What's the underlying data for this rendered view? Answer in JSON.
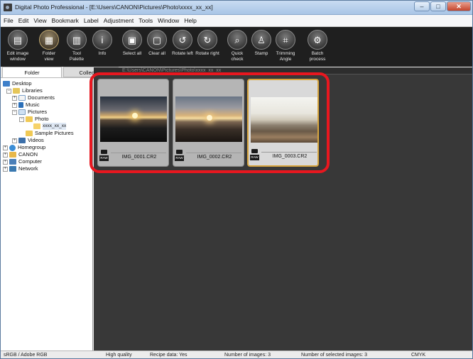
{
  "window": {
    "title": "Digital Photo Professional - [E:\\Users\\CANON\\Pictures\\Photo\\xxxx_xx_xx]",
    "buttons": {
      "minimize": "–",
      "maximize": "□",
      "close": "✕"
    }
  },
  "menu": [
    "File",
    "Edit",
    "View",
    "Bookmark",
    "Label",
    "Adjustment",
    "Tools",
    "Window",
    "Help"
  ],
  "toolbar": {
    "tools": [
      {
        "id": "edit-image-window",
        "label": "Edit image\nwindow",
        "icon": "edit-image-icon",
        "glyph": "▤",
        "active": false
      },
      {
        "id": "folder-view",
        "label": "Folder\nview",
        "icon": "folder-view-icon",
        "glyph": "▦",
        "active": true
      },
      {
        "id": "tool-palette",
        "label": "Tool\nPalette",
        "icon": "tool-palette-icon",
        "glyph": "▥",
        "active": false
      },
      {
        "id": "info",
        "label": "Info",
        "icon": "info-icon",
        "glyph": "i",
        "active": false
      },
      {
        "id": "select-all",
        "label": "Select all",
        "icon": "select-all-icon",
        "glyph": "▣",
        "active": false
      },
      {
        "id": "clear-all",
        "label": "Clear all",
        "icon": "clear-all-icon",
        "glyph": "▢",
        "active": false
      },
      {
        "id": "rotate-left",
        "label": "Rotate left",
        "icon": "rotate-left-icon",
        "glyph": "↺",
        "active": false
      },
      {
        "id": "rotate-right",
        "label": "Rotate right",
        "icon": "rotate-right-icon",
        "glyph": "↻",
        "active": false
      },
      {
        "id": "quick-check",
        "label": "Quick\ncheck",
        "icon": "quick-check-icon",
        "glyph": "⌕",
        "active": false
      },
      {
        "id": "stamp",
        "label": "Stamp",
        "icon": "stamp-icon",
        "glyph": "♙",
        "active": false
      },
      {
        "id": "trimming-angle",
        "label": "Trimming\nAngle",
        "icon": "trimming-angle-icon",
        "glyph": "⌗",
        "active": false
      },
      {
        "id": "batch-process",
        "label": "Batch\nprocess",
        "icon": "batch-process-icon",
        "glyph": "⚙",
        "active": false
      }
    ]
  },
  "tabs": {
    "folder": "Folder",
    "collection": "Collection"
  },
  "tree": {
    "desktop": "Desktop",
    "libraries": "Libraries",
    "documents": "Documents",
    "music": "Music",
    "pictures": "Pictures",
    "photo": "Photo",
    "date_folder": "xxxx_xx_xx",
    "sample_pictures": "Sample Pictures",
    "videos": "Videos",
    "homegroup": "Homegroup",
    "canon": "CANON",
    "computer": "Computer",
    "network": "Network"
  },
  "content": {
    "path": "E:\\Users\\CANON\\Pictures\\Photo\\xxxx_xx_xx",
    "raw_badge": "RAW",
    "thumbnails": [
      {
        "filename": "IMG_0001.CR2",
        "selected": false
      },
      {
        "filename": "IMG_0002.CR2",
        "selected": false
      },
      {
        "filename": "IMG_0003.CR2",
        "selected": true
      }
    ]
  },
  "status": {
    "color_space": "sRGB / Adobe RGB",
    "quality": "High quality",
    "recipe": "Recipe data: Yes",
    "num_images": "Number of images: 3",
    "num_selected": "Number of selected images: 3",
    "cmyk": "CMYK"
  },
  "colors": {
    "toolbar_bg": "#1f1f1f",
    "content_bg": "#383838",
    "highlight": "#e8171f",
    "selected_border": "#d8a640"
  }
}
